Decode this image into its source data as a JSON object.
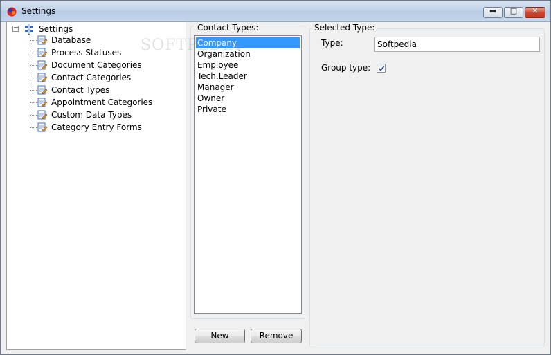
{
  "window": {
    "title": "Settings",
    "controls": {
      "minimize": "▬",
      "maximize": "□",
      "close": "✕"
    }
  },
  "tree": {
    "root_label": "Settings",
    "toggle": "−",
    "items": [
      {
        "label": "Database"
      },
      {
        "label": "Process Statuses"
      },
      {
        "label": "Document Categories"
      },
      {
        "label": "Contact Categories"
      },
      {
        "label": "Contact Types"
      },
      {
        "label": "Appointment Categories"
      },
      {
        "label": "Custom Data Types"
      },
      {
        "label": "Category Entry Forms"
      }
    ]
  },
  "contact_types": {
    "group_label": "Contact Types:",
    "items": [
      "Company",
      "Organization",
      "Employee",
      "Tech.Leader",
      "Manager",
      "Owner",
      "Private"
    ],
    "selected_index": 0,
    "new_label": "New",
    "remove_label": "Remove"
  },
  "selected_type": {
    "group_label": "Selected Type:",
    "type_label": "Type:",
    "type_value": "Softpedia",
    "group_type_label": "Group type:",
    "group_type_checked": true
  },
  "watermark": "SOFTPEDIA",
  "colors": {
    "selection": "#3399ff",
    "titlebar": "#c2d3e8",
    "close_button": "#c8452f"
  }
}
